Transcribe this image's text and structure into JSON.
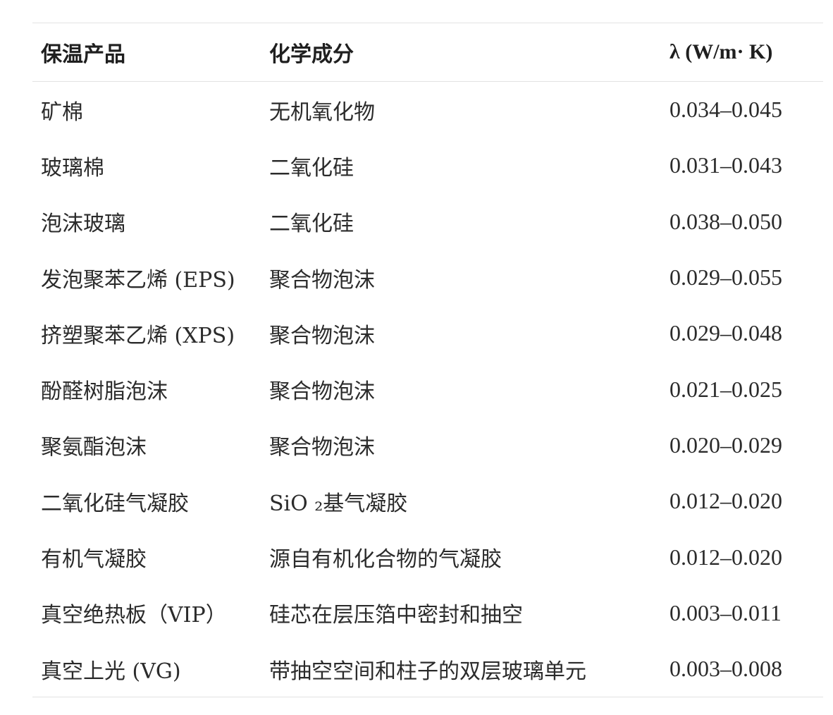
{
  "table": {
    "headers": {
      "product": "保温产品",
      "composition": "化学成分",
      "lambda": "λ (W/m· K)"
    },
    "rows": [
      {
        "product": "矿棉",
        "composition": "无机氧化物",
        "lambda": "0.034–0.045"
      },
      {
        "product": "玻璃棉",
        "composition": "二氧化硅",
        "lambda": "0.031–0.043"
      },
      {
        "product": "泡沫玻璃",
        "composition": "二氧化硅",
        "lambda": "0.038–0.050"
      },
      {
        "product": "发泡聚苯乙烯 (EPS)",
        "composition": "聚合物泡沫",
        "lambda": "0.029–0.055"
      },
      {
        "product": "挤塑聚苯乙烯 (XPS)",
        "composition": "聚合物泡沫",
        "lambda": "0.029–0.048"
      },
      {
        "product": "酚醛树脂泡沫",
        "composition": "聚合物泡沫",
        "lambda": "0.021–0.025"
      },
      {
        "product": "聚氨酯泡沫",
        "composition": "聚合物泡沫",
        "lambda": "0.020–0.029"
      },
      {
        "product": "二氧化硅气凝胶",
        "composition": "SiO ₂基气凝胶",
        "lambda": "0.012–0.020"
      },
      {
        "product": "有机气凝胶",
        "composition": "源自有机化合物的气凝胶",
        "lambda": "0.012–0.020"
      },
      {
        "product": "真空绝热板（VIP）",
        "composition": "硅芯在层压箔中密封和抽空",
        "lambda": "0.003–0.011"
      },
      {
        "product": "真空上光 (VG)",
        "composition": "带抽空空间和柱子的双层玻璃单元",
        "lambda": "0.003–0.008"
      }
    ]
  }
}
